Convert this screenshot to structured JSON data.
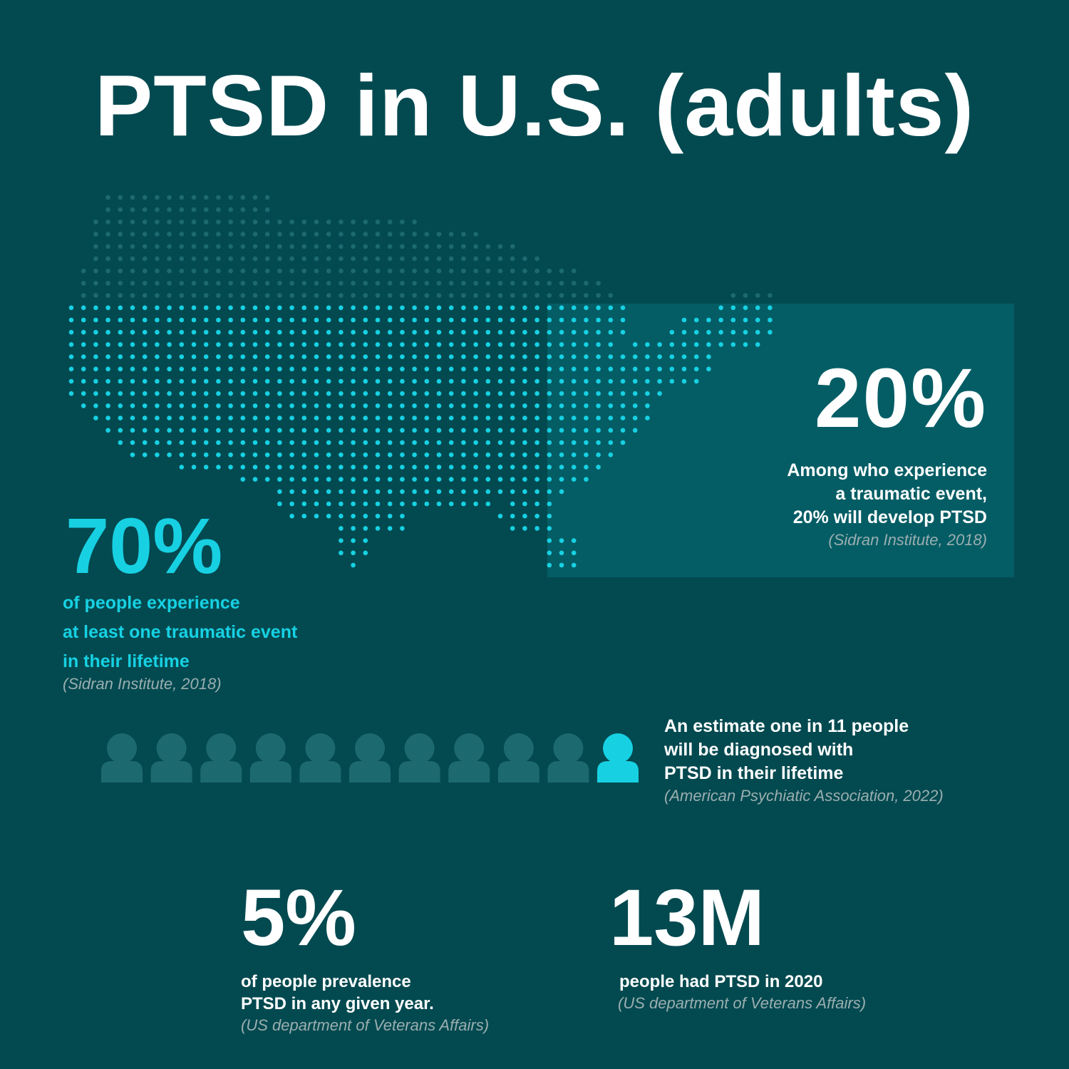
{
  "title": "PTSD in U.S. (adults)",
  "colors": {
    "background": "#034a50",
    "highlight_box": "#045d65",
    "accent_cyan": "#17d1e3",
    "dot_dim": "#1d6970",
    "person_dim": "#1d6970",
    "source_gray": "#9aaeb0"
  },
  "map": {
    "icon": "us-dot-map"
  },
  "stat_70": {
    "value": "70%",
    "lines": [
      "of people experience",
      "at least one traumatic event",
      "in their lifetime"
    ],
    "source": "(Sidran Institute, 2018)"
  },
  "stat_20": {
    "value": "20%",
    "lines": [
      "Among who experience",
      "a traumatic event,",
      "20% will develop PTSD"
    ],
    "source": "(Sidran Institute, 2018)"
  },
  "stat_11": {
    "people_total": 11,
    "people_highlighted": 1,
    "lines": [
      "An estimate one in 11 people",
      "will be diagnosed with",
      "PTSD in their lifetime"
    ],
    "source": "(American Psychiatic Association, 2022)"
  },
  "stat_5": {
    "value": "5%",
    "lines": [
      "of people prevalence",
      "PTSD in any given year."
    ],
    "source": "(US department of Veterans Affairs)"
  },
  "stat_13m": {
    "value": "13M",
    "lines": [
      "people had PTSD in 2020"
    ],
    "source": "(US department of Veterans Affairs)"
  }
}
